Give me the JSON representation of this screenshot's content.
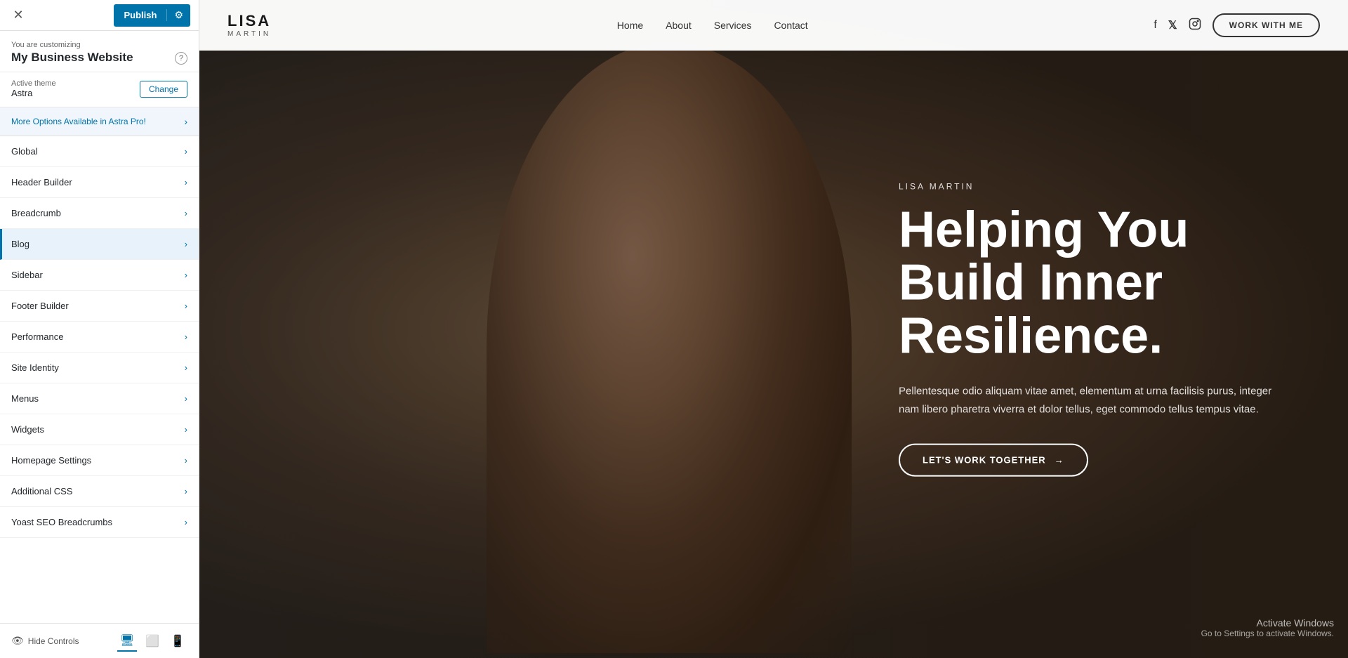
{
  "topBar": {
    "publishLabel": "Publish",
    "gearIcon": "⚙",
    "closeIcon": "✕"
  },
  "customizing": {
    "label": "You are customizing",
    "siteTitle": "My Business Website",
    "helpIcon": "?"
  },
  "activeTheme": {
    "label": "Active theme",
    "themeName": "Astra",
    "changeLabel": "Change"
  },
  "astraPro": {
    "text": "More Options Available in Astra Pro!",
    "chevron": "›"
  },
  "menuItems": [
    {
      "label": "Global",
      "active": false
    },
    {
      "label": "Header Builder",
      "active": false
    },
    {
      "label": "Breadcrumb",
      "active": false
    },
    {
      "label": "Blog",
      "active": true
    },
    {
      "label": "Sidebar",
      "active": false
    },
    {
      "label": "Footer Builder",
      "active": false
    },
    {
      "label": "Performance",
      "active": false
    },
    {
      "label": "Site Identity",
      "active": false
    },
    {
      "label": "Menus",
      "active": false
    },
    {
      "label": "Widgets",
      "active": false
    },
    {
      "label": "Homepage Settings",
      "active": false
    },
    {
      "label": "Additional CSS",
      "active": false
    },
    {
      "label": "Yoast SEO Breadcrumbs",
      "active": false
    }
  ],
  "bottomBar": {
    "hideControls": "Hide Controls",
    "desktopIcon": "🖥",
    "tabletIcon": "📄",
    "mobileIcon": "📱"
  },
  "preview": {
    "logoName": "LISA",
    "logoSub": "MARTIN",
    "nav": [
      "Home",
      "About",
      "Services",
      "Contact"
    ],
    "workWithMe": "WORK WITH ME",
    "heroAuthor": "LISA MARTIN",
    "heroHeadline": "Helping You Build Inner Resilience.",
    "heroSubtext": "Pellentesque odio aliquam vitae amet, elementum at urna facilisis purus, integer nam libero pharetra viverra et dolor tellus, eget commodo tellus tempus vitae.",
    "heroCta": "LET'S WORK TOGETHER",
    "heroCtaArrow": "→",
    "activateWindows": "Activate Windows",
    "activateSub": "Go to Settings to activate Windows."
  }
}
